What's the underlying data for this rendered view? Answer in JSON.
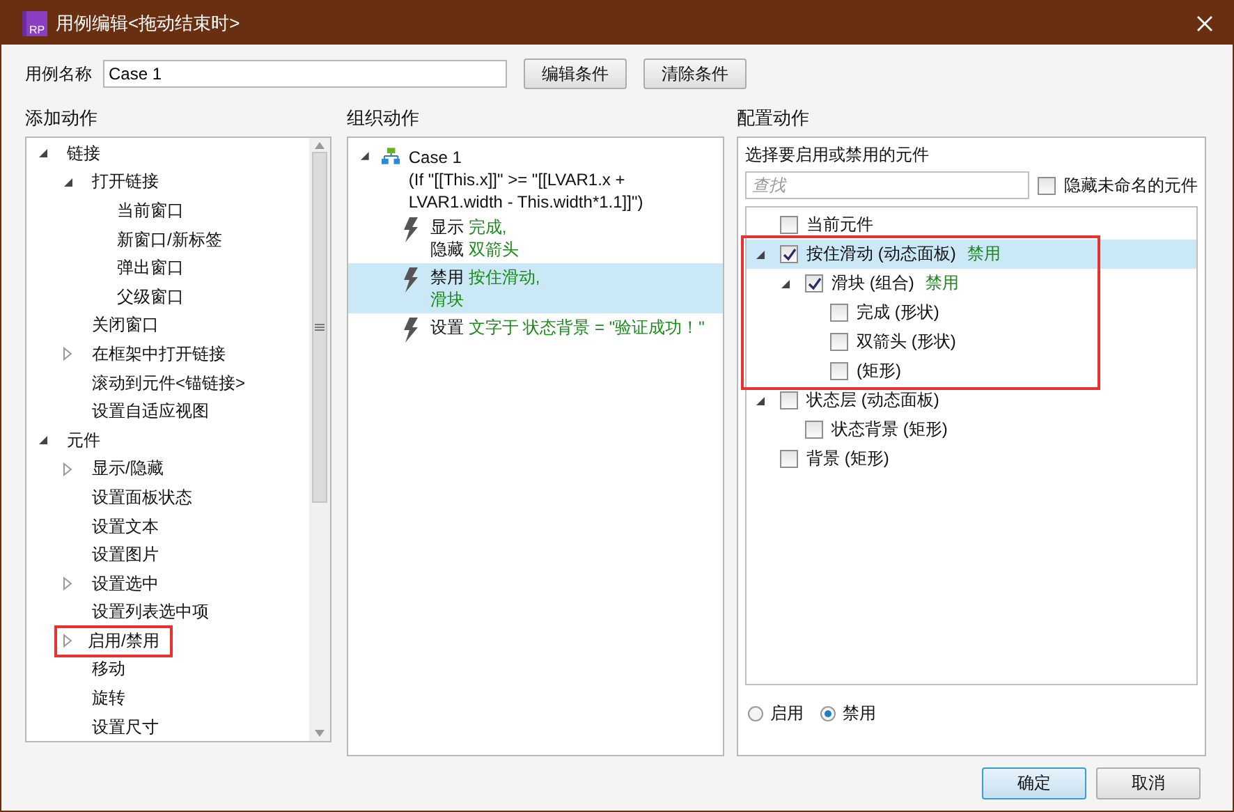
{
  "window": {
    "title": "用例编辑<拖动结束时>",
    "app_badge": "RP"
  },
  "case_name": {
    "label": "用例名称",
    "value": "Case 1"
  },
  "header_buttons": [
    "编辑条件",
    "清除条件"
  ],
  "add_actions": {
    "title": "添加动作",
    "items": [
      {
        "label": "链接",
        "expanded": true,
        "children": [
          {
            "label": "打开链接",
            "expanded": true,
            "children": [
              {
                "label": "当前窗口"
              },
              {
                "label": "新窗口/新标签"
              },
              {
                "label": "弹出窗口"
              },
              {
                "label": "父级窗口"
              }
            ]
          },
          {
            "label": "关闭窗口"
          },
          {
            "label": "在框架中打开链接",
            "expanded": false
          },
          {
            "label": "滚动到元件<锚链接>"
          },
          {
            "label": "设置自适应视图"
          }
        ]
      },
      {
        "label": "元件",
        "expanded": true,
        "children": [
          {
            "label": "显示/隐藏",
            "expanded": false
          },
          {
            "label": "设置面板状态"
          },
          {
            "label": "设置文本"
          },
          {
            "label": "设置图片"
          },
          {
            "label": "设置选中",
            "expanded": false
          },
          {
            "label": "设置列表选中项"
          },
          {
            "label": "启用/禁用",
            "expanded": false,
            "highlighted": true
          },
          {
            "label": "移动"
          },
          {
            "label": "旋转"
          },
          {
            "label": "设置尺寸"
          }
        ]
      }
    ]
  },
  "organize": {
    "title": "组织动作",
    "case": {
      "name": "Case 1",
      "condition": "(If \"[[This.x]]\" >= \"[[LVAR1.x + LVAR1.width - This.width*1.1]]\")",
      "expanded": true
    },
    "actions": [
      {
        "selected": false,
        "lines": [
          {
            "verb": "显示",
            "target": "完成,"
          },
          {
            "verb": "隐藏",
            "target": "双箭头"
          }
        ]
      },
      {
        "selected": true,
        "lines": [
          {
            "verb": "禁用",
            "target": "按住滑动,"
          },
          {
            "target": "滑块"
          }
        ]
      },
      {
        "selected": false,
        "lines": [
          {
            "verb": "设置",
            "target": "文字于 状态背景 = \"验证成功！\""
          }
        ]
      }
    ]
  },
  "configure": {
    "title": "配置动作",
    "prompt": "选择要启用或禁用的元件",
    "search": {
      "placeholder": "查找"
    },
    "hide_unnamed": {
      "label": "隐藏未命名的元件",
      "checked": false
    },
    "elements": [
      {
        "label": "当前元件",
        "checked": false,
        "selected": false
      },
      {
        "label": "按住滑动 (动态面板)",
        "status": "禁用",
        "checked": true,
        "selected": true,
        "expanded": true,
        "highlighted": true,
        "children": [
          {
            "label": "滑块 (组合)",
            "status": "禁用",
            "checked": true,
            "selected": false,
            "expanded": true,
            "children": [
              {
                "label": "完成 (形状)",
                "checked": false,
                "selected": false
              },
              {
                "label": "双箭头 (形状)",
                "checked": false,
                "selected": false
              },
              {
                "label": "(矩形)",
                "checked": false,
                "selected": false
              }
            ]
          }
        ]
      },
      {
        "label": "状态层 (动态面板)",
        "checked": false,
        "selected": false,
        "expanded": true,
        "children": [
          {
            "label": "状态背景 (矩形)",
            "checked": false,
            "selected": false
          }
        ]
      },
      {
        "label": "背景 (矩形)",
        "checked": false,
        "selected": false
      }
    ],
    "radios": [
      {
        "label": "启用",
        "selected": false
      },
      {
        "label": "禁用",
        "selected": true
      }
    ]
  },
  "footer_buttons": [
    {
      "label": "确定",
      "kind": "default"
    },
    {
      "label": "取消",
      "kind": "normal"
    }
  ]
}
